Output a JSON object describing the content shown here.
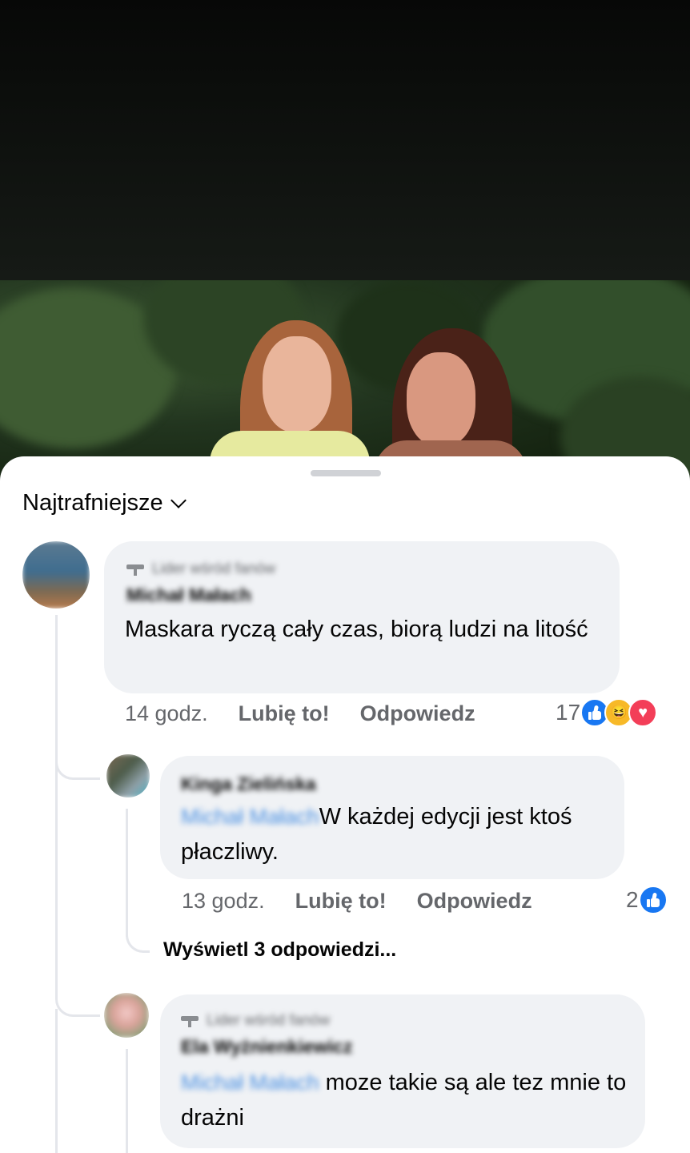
{
  "video": {
    "description_icon": "video-player-frame"
  },
  "sheet": {
    "sort_label": "Najtrafniejsze",
    "sort_icon": "chevron-down-icon"
  },
  "comments": [
    {
      "badge": "Lider wśród fanów",
      "author": "Michał Małach",
      "text": "Maskara ryczą cały czas, biorą ludzi na litość",
      "time": "14 godz.",
      "like_label": "Lubię to!",
      "reply_label": "Odpowiedz",
      "reaction_count": "17",
      "reactions": [
        "like-icon",
        "haha-icon",
        "love-icon"
      ]
    },
    {
      "author": "Kinga Zielińska",
      "mention": "Michał Małach",
      "text": "W każdej edycji jest ktoś płaczliwy.",
      "time": "13 godz.",
      "like_label": "Lubię to!",
      "reply_label": "Odpowiedz",
      "reaction_count": "2",
      "reactions": [
        "like-icon"
      ]
    },
    {
      "badge": "Lider wśród fanów",
      "author": "Ela Wyżnienkiewicz",
      "mention": "Michał Małach",
      "text": "moze takie są ale tez mnie to drażni"
    }
  ],
  "view_replies_label": "Wyświetl 3 odpowiedzi..."
}
